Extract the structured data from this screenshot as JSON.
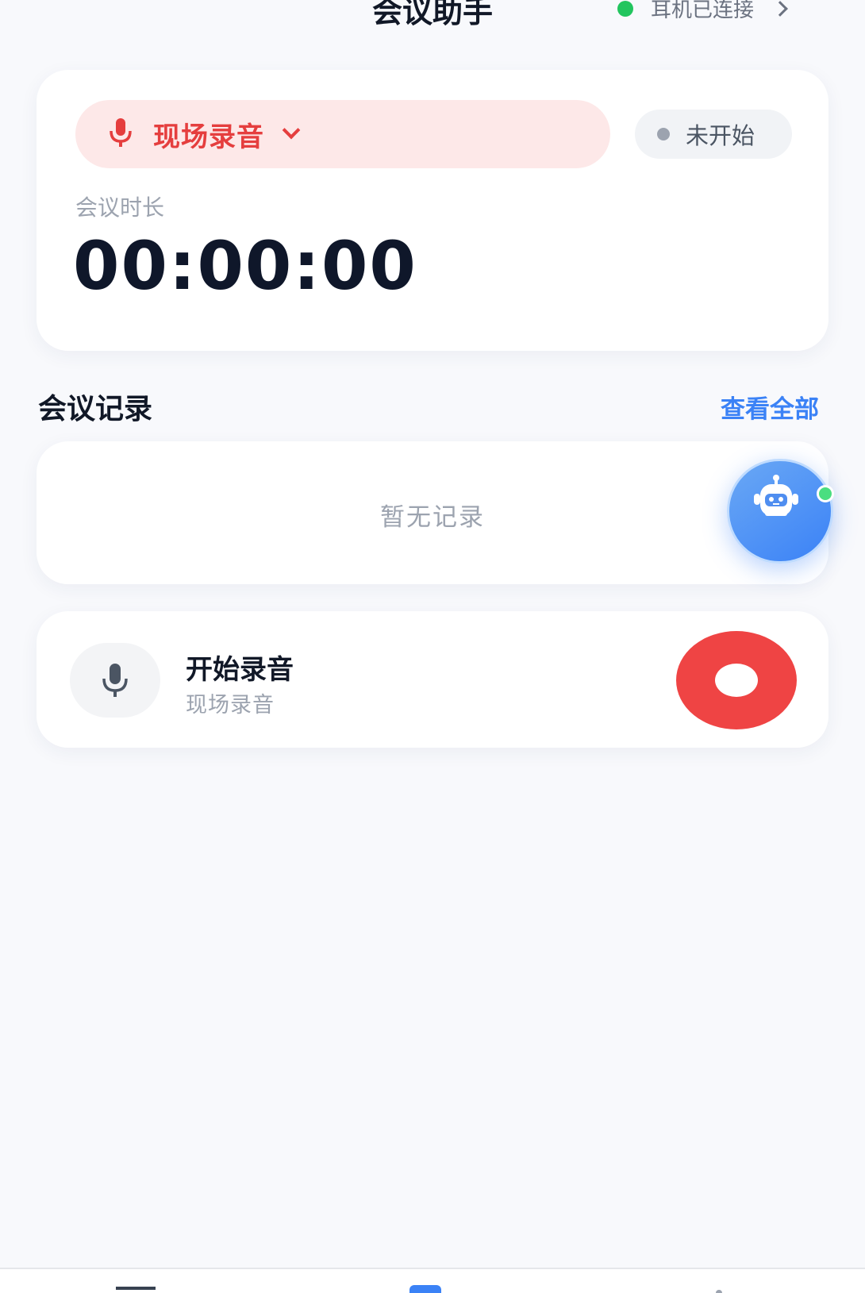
{
  "header": {
    "title": "会议助手",
    "connection_status": "耳机已连接"
  },
  "session": {
    "mode_label": "现场录音",
    "status_label": "未开始",
    "duration_label": "会议时长",
    "timer": "00:00:00"
  },
  "records": {
    "section_title": "会议记录",
    "view_all": "查看全部",
    "empty_text": "暂无记录"
  },
  "recorder": {
    "title": "开始录音",
    "subtitle": "现场录音"
  },
  "colors": {
    "accent": "#3b82f6",
    "record_red": "#ef4444",
    "connected_green": "#22c55e"
  }
}
